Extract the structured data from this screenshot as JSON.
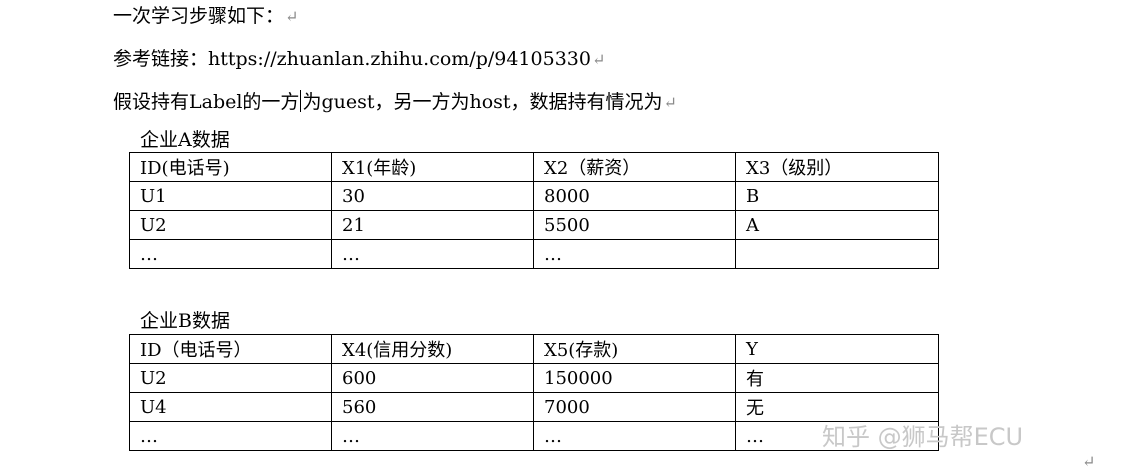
{
  "paragraphs": {
    "p1": "一次学习步骤如下：",
    "p2": "参考链接：https://zhuanlan.zhihu.com/p/94105330",
    "p3a": "假设持有Label的一方",
    "p3b": "为guest，另一方为host，数据持有情况为"
  },
  "return_mark": "↵",
  "tableA": {
    "caption": "企业A数据",
    "header": [
      "ID(电话号)",
      "X1(年龄)",
      "X2（薪资）",
      "X3（级别）"
    ],
    "rows": [
      [
        "U1",
        "30",
        "8000",
        "B"
      ],
      [
        "U2",
        "21",
        "5500",
        "A"
      ],
      [
        "…",
        "…",
        "…",
        ""
      ]
    ]
  },
  "tableB": {
    "caption": "企业B数据",
    "header": [
      "ID（电话号）",
      "X4(信用分数)",
      "X5(存款)",
      "Y"
    ],
    "rows": [
      [
        "U2",
        "600",
        "150000",
        "有"
      ],
      [
        "U4",
        "560",
        "7000",
        "无"
      ],
      [
        "…",
        "…",
        "…",
        "…"
      ]
    ]
  },
  "watermark": "知乎 @狮马帮ECU"
}
